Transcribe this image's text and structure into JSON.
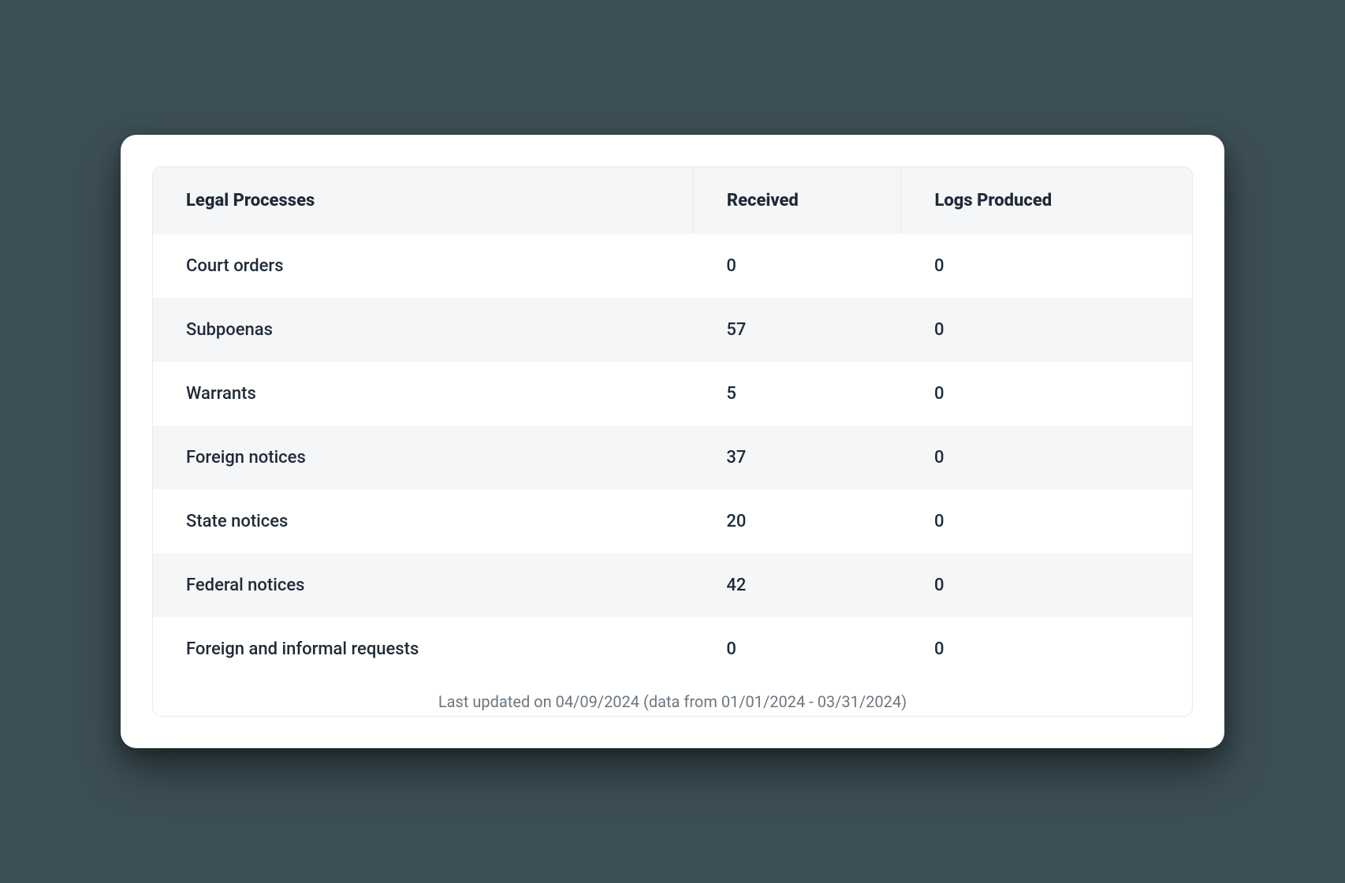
{
  "table": {
    "columns": [
      "Legal Processes",
      "Received",
      "Logs Produced"
    ],
    "rows": [
      {
        "process": "Court orders",
        "received": "0",
        "logs": "0"
      },
      {
        "process": "Subpoenas",
        "received": "57",
        "logs": "0"
      },
      {
        "process": "Warrants",
        "received": "5",
        "logs": "0"
      },
      {
        "process": "Foreign notices",
        "received": "37",
        "logs": "0"
      },
      {
        "process": "State notices",
        "received": "20",
        "logs": "0"
      },
      {
        "process": "Federal notices",
        "received": "42",
        "logs": "0"
      },
      {
        "process": "Foreign and informal requests",
        "received": "0",
        "logs": "0"
      }
    ],
    "footer": "Last updated on 04/09/2024 (data from 01/01/2024 - 03/31/2024)"
  },
  "chart_data": {
    "type": "table",
    "title": "Legal Processes",
    "columns": [
      "Legal Processes",
      "Received",
      "Logs Produced"
    ],
    "rows": [
      [
        "Court orders",
        0,
        0
      ],
      [
        "Subpoenas",
        57,
        0
      ],
      [
        "Warrants",
        5,
        0
      ],
      [
        "Foreign notices",
        37,
        0
      ],
      [
        "State notices",
        20,
        0
      ],
      [
        "Federal notices",
        42,
        0
      ],
      [
        "Foreign and informal requests",
        0,
        0
      ]
    ],
    "note": "Last updated on 04/09/2024 (data from 01/01/2024 - 03/31/2024)"
  }
}
